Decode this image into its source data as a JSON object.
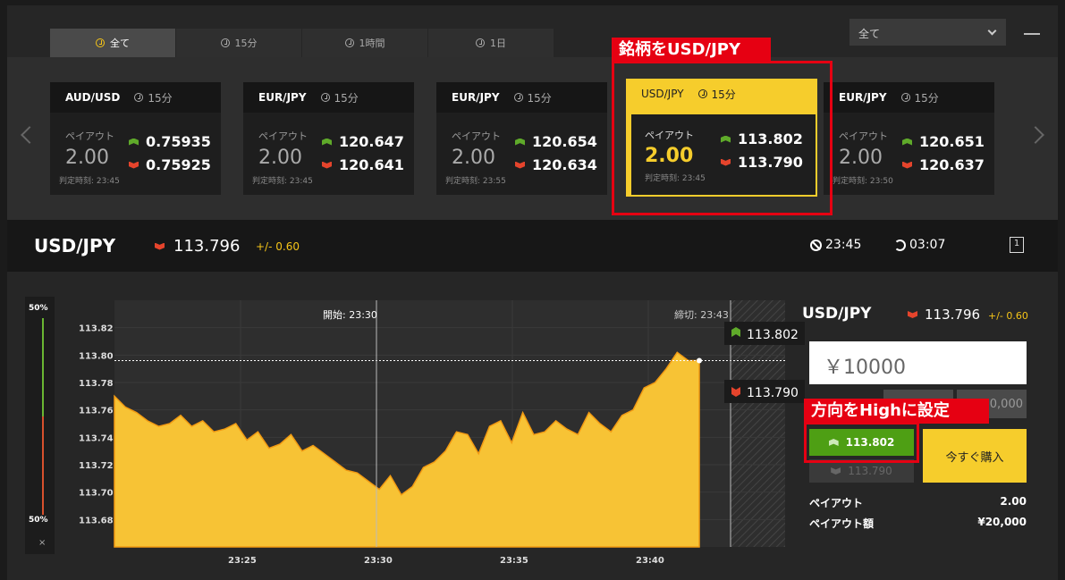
{
  "tabs": [
    {
      "label": "全て"
    },
    {
      "label": "15分"
    },
    {
      "label": "1時間"
    },
    {
      "label": "1日"
    }
  ],
  "filter_select": "全て",
  "cards": [
    {
      "symbol": "AUD/USD",
      "period": "15分",
      "payout_label": "ペイアウト",
      "payout": "2.00",
      "high": "0.75935",
      "low": "0.75925",
      "deadline": "判定時刻: 23:45"
    },
    {
      "symbol": "EUR/JPY",
      "period": "15分",
      "payout_label": "ペイアウト",
      "payout": "2.00",
      "high": "120.647",
      "low": "120.641",
      "deadline": "判定時刻: 23:45"
    },
    {
      "symbol": "EUR/JPY",
      "period": "15分",
      "payout_label": "ペイアウト",
      "payout": "2.00",
      "high": "120.654",
      "low": "120.634",
      "deadline": "判定時刻: 23:55"
    },
    {
      "symbol": "USD/JPY",
      "period": "15分",
      "payout_label": "ペイアウト",
      "payout": "2.00",
      "high": "113.802",
      "low": "113.790",
      "deadline": "判定時刻: 23:45"
    },
    {
      "symbol": "EUR/JPY",
      "period": "15分",
      "payout_label": "ペイアウト",
      "payout": "2.00",
      "high": "120.651",
      "low": "120.637",
      "deadline": "判定時刻: 23:50"
    }
  ],
  "annotations": {
    "select_symbol": "銘柄をUSD/JPY",
    "select_direction": "方向をHighに設定"
  },
  "asset": {
    "symbol": "USD/JPY",
    "price": "113.796",
    "change": "+/- 0.60",
    "deadline_time": "23:45",
    "remaining": "03:07",
    "icon_text": "1"
  },
  "meter": {
    "top": "50%",
    "bottom": "50%",
    "close": "×"
  },
  "chart_data": {
    "type": "area",
    "ylim": [
      113.66,
      113.84
    ],
    "yticks": [
      "113.82",
      "113.80",
      "113.78",
      "113.76",
      "113.74",
      "113.72",
      "113.70",
      "113.68"
    ],
    "xticks": [
      "23:25",
      "23:30",
      "23:35",
      "23:40"
    ],
    "start_label": "開始: 23:30",
    "end_label": "締切: 23:43",
    "high_tag": "113.802",
    "low_tag": "113.790",
    "current": 113.796,
    "values": [
      113.77,
      113.762,
      113.758,
      113.752,
      113.748,
      113.75,
      113.756,
      113.748,
      113.752,
      113.744,
      113.746,
      113.75,
      113.738,
      113.744,
      113.732,
      113.735,
      113.742,
      113.73,
      113.734,
      113.728,
      113.722,
      113.716,
      113.714,
      113.708,
      113.702,
      113.712,
      113.698,
      113.704,
      113.718,
      113.722,
      113.73,
      113.744,
      113.742,
      113.728,
      113.748,
      113.752,
      113.736,
      113.758,
      113.742,
      113.744,
      113.752,
      113.746,
      113.742,
      113.758,
      113.75,
      113.744,
      113.756,
      113.76,
      113.776,
      113.78,
      113.79,
      113.802,
      113.796,
      113.796
    ]
  },
  "panel": {
    "symbol": "USD/JPY",
    "price": "113.796",
    "change": "+/- 0.60",
    "amount": "￥10000",
    "quick_amount": "0,000",
    "high_btn": "113.802",
    "low_btn": "113.790",
    "buy": "今すぐ購入",
    "payout_label": "ペイアウト",
    "payout_value": "2.00",
    "payout_amount_label": "ペイアウト額",
    "payout_amount_value": "¥20,000"
  },
  "colors": {
    "accent": "#f6cd2c",
    "high": "#4e9f14",
    "low": "#e5442c",
    "annotation": "#e60012"
  }
}
